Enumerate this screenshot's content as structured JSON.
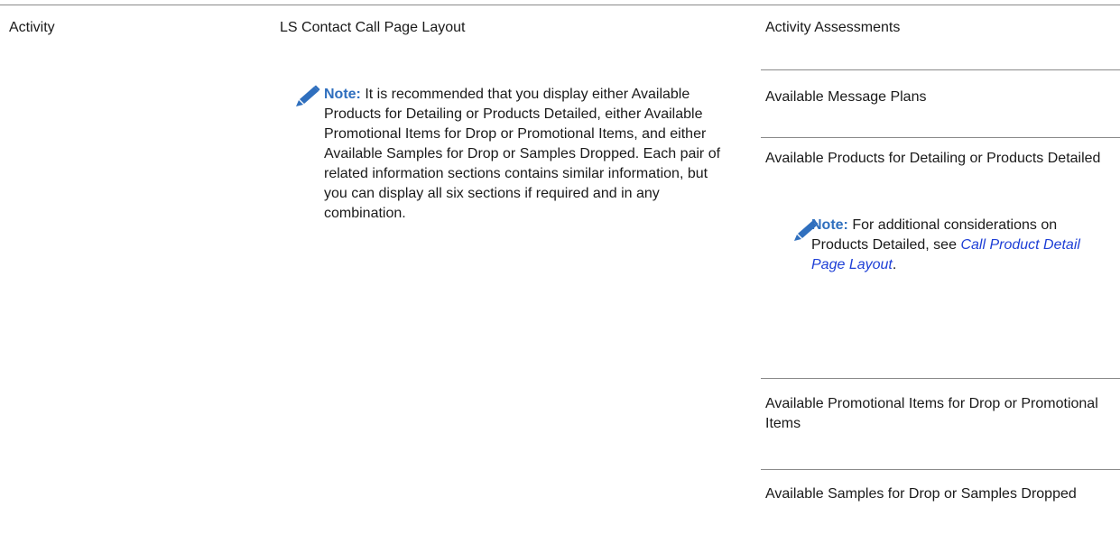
{
  "row": {
    "activity": "Activity",
    "layout_name": "LS Contact Call Page Layout",
    "layout_note": {
      "label": "Note:",
      "text": "It is recommended that you display either Available Products for Detailing or Products Detailed, either Available Promotional Items for Drop or Promotional Items, and either Available Samples for Drop or Samples Dropped. Each pair of related information sections contains similar information, but you can display all six sections if required and in any combination."
    },
    "sections": [
      {
        "label": "Activity Assessments"
      },
      {
        "label": "Available Message Plans"
      },
      {
        "label": "Available Products for Detailing or Products Detailed",
        "note": {
          "label": "Note:",
          "text_before": "For additional considerations on Products Detailed, see",
          "link": "Call Product Detail Page Layout",
          "text_after": "."
        }
      },
      {
        "label": "Available Promotional Items for Drop or Promotional Items"
      },
      {
        "label": "Available Samples for Drop or Samples Dropped"
      }
    ]
  },
  "colors": {
    "note_label": "#2f6fbe",
    "pencil_icon": "#2f6fbe",
    "link": "#1e3fd6",
    "rule": "#8a8a8a"
  }
}
